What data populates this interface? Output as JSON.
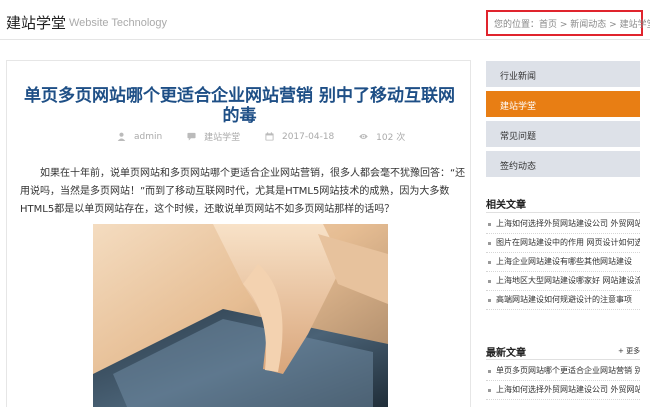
{
  "header": {
    "title": "建站学堂",
    "subtitle": "Website Technology",
    "breadcrumb": {
      "prefix": "您的位置：",
      "items": [
        "首页",
        "新闻动态",
        "建站学堂"
      ],
      "separator": " > "
    }
  },
  "article": {
    "title": "单页多页网站哪个更适合企业网站营销 别中了移动互联网的毒",
    "meta": {
      "author": "admin",
      "category": "建站学堂",
      "date": "2017-04-18",
      "views": "102 次"
    },
    "body": "如果在十年前，说单页网站和多页网站哪个更适合企业网站营销，很多人都会毫不犹豫回答：“还用说吗，当然是多页网站！”而到了移动互联网时代，尤其是HTML5网站技术的成熟，因为大多数HTML5都是以单页网站存在，这个时候，还敢说单页网站不如多页网站那样的话吗？"
  },
  "sidebar": {
    "nav": [
      {
        "label": "行业新闻",
        "active": false
      },
      {
        "label": "建站学堂",
        "active": true
      },
      {
        "label": "常见问题",
        "active": false
      },
      {
        "label": "签约动态",
        "active": false
      }
    ],
    "related": {
      "title": "相关文章",
      "items": [
        "上海如何选择外贸网站建设公司 外贸网站",
        "图片在网站建设中的作用 网页设计如何选",
        "上海企业网站建设有哪些其他网站建设",
        "上海地区大型网站建设哪家好 网站建设流",
        "高端网站建设如何规避设计的注意事项"
      ]
    },
    "latest": {
      "title": "最新文章",
      "more": "+ 更多",
      "items": [
        "单页多页网站哪个更适合企业网站营销 别",
        "上海如何选择外贸网站建设公司 外贸网站"
      ]
    }
  },
  "colors": {
    "accent": "#e87e14",
    "title_blue": "#1e4f86",
    "breadcrumb_border": "#e0242d",
    "nav_bg": "#dde1e8"
  }
}
